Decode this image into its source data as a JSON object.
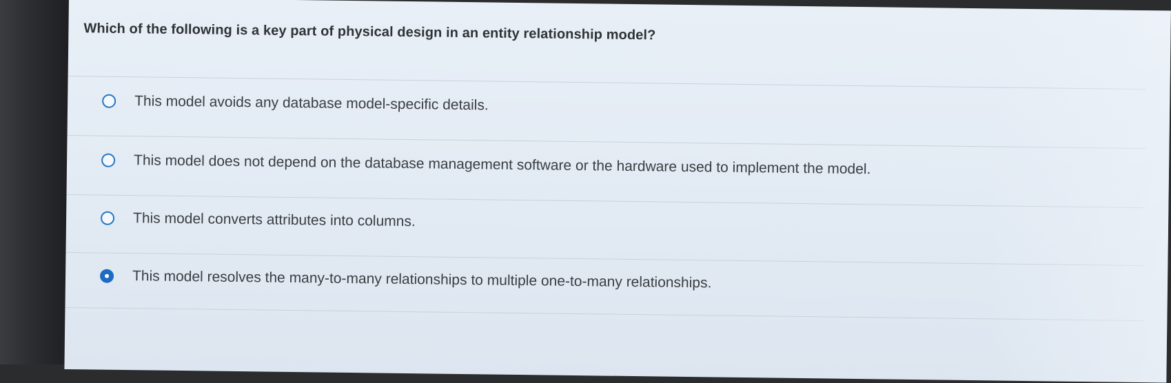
{
  "question": {
    "text": "Which of the following is a key part of physical design in an entity relationship model?"
  },
  "options": [
    {
      "label": "This model avoids any database model-specific details.",
      "selected": false
    },
    {
      "label": "This model does not depend on the database management software or the hardware used to implement the model.",
      "selected": false
    },
    {
      "label": "This model converts attributes into columns.",
      "selected": false
    },
    {
      "label": "This model resolves the many-to-many relationships to multiple one-to-many relationships.",
      "selected": true
    }
  ],
  "colors": {
    "accent": "#1e6bc2",
    "text": "#3a3e42",
    "background": "#e4ecf5"
  }
}
